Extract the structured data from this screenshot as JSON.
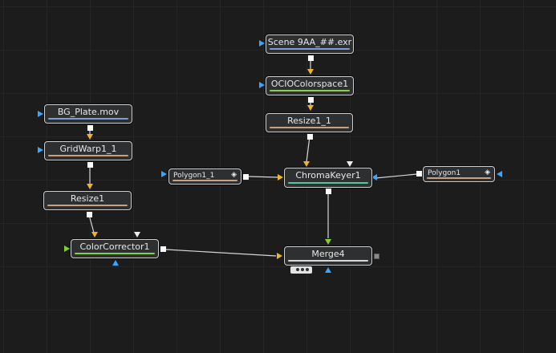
{
  "nodes": {
    "scene": {
      "label": "Scene 9AA_##.exr",
      "bar_color": "#7e9ed8"
    },
    "ocio": {
      "label": "OCIOColorspace1",
      "bar_color": "#84d14a"
    },
    "resize1_1": {
      "label": "Resize1_1",
      "bar_color": "#c8a180"
    },
    "bg_plate": {
      "label": "BG_Plate.mov",
      "bar_color": "#7e9ed8"
    },
    "gridwarp": {
      "label": "GridWarp1_1",
      "bar_color": "#c8a180"
    },
    "resize1": {
      "label": "Resize1",
      "bar_color": "#c8a180"
    },
    "polygon1_1": {
      "label": "Polygon1_1",
      "bar_color": "#c8a180"
    },
    "chromakeyer": {
      "label": "ChromaKeyer1",
      "bar_color": "#55c79a"
    },
    "polygon1": {
      "label": "Polygon1",
      "bar_color": "#c8a180"
    },
    "colorcorrector": {
      "label": "ColorCorrector1",
      "bar_color": "#84d14a"
    },
    "merge": {
      "label": "Merge4",
      "bar_color": "#d8d8d8"
    }
  },
  "colors": {
    "background": "#1c1c1c",
    "node_fill": "#2e2f31",
    "wire": "#d6d6d6",
    "input_blue": "#36a6ff",
    "input_yellow": "#f0b428",
    "input_green": "#7fd130"
  },
  "icons": {
    "mask_toggle": "half-diamond-icon"
  }
}
